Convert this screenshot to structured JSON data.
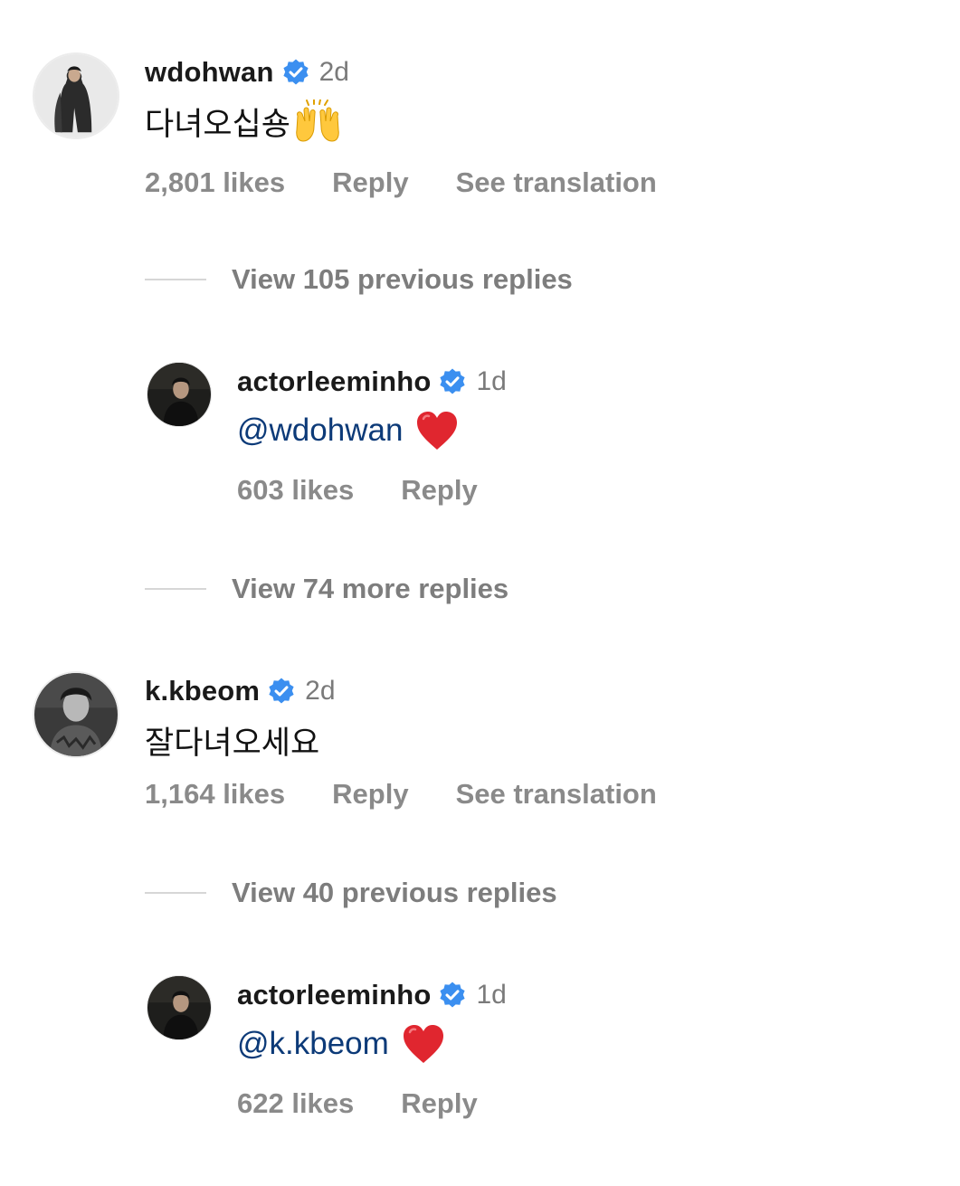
{
  "comments": [
    {
      "username": "wdohwan",
      "verified": true,
      "time": "2d",
      "text": "다녀오십숑",
      "emoji": "raising-hands",
      "likes": "2,801 likes",
      "reply_label": "Reply",
      "translate_label": "See translation",
      "view_replies": "View 105 previous replies",
      "reply": {
        "username": "actorleeminho",
        "verified": true,
        "time": "1d",
        "mention": "@wdohwan",
        "emoji": "red-heart",
        "likes": "603 likes",
        "reply_label": "Reply"
      },
      "view_more": "View 74 more replies"
    },
    {
      "username": "k.kbeom",
      "verified": true,
      "time": "2d",
      "text": "잘다녀오세요",
      "likes": "1,164 likes",
      "reply_label": "Reply",
      "translate_label": "See translation",
      "view_replies": "View 40 previous replies",
      "reply": {
        "username": "actorleeminho",
        "verified": true,
        "time": "1d",
        "mention": "@k.kbeom",
        "emoji": "red-heart",
        "likes": "622 likes",
        "reply_label": "Reply"
      }
    }
  ],
  "colors": {
    "verified_badge": "#3b8ff0",
    "mention": "#0c3a78",
    "secondary_text": "#8a8a8a",
    "heart": "#e0262f"
  }
}
